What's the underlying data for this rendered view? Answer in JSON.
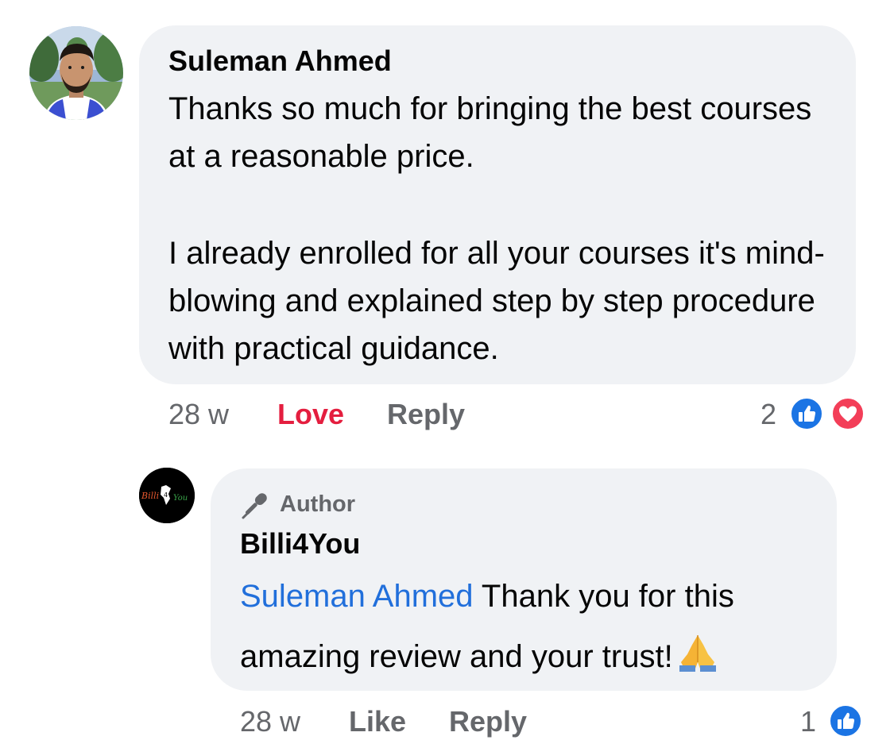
{
  "comment": {
    "author": "Suleman Ahmed",
    "paragraphs": [
      "Thanks so much for bringing the best courses at a reasonable price.",
      "I already enrolled for all your courses it's mind-blowing and explained step by step procedure with practical guidance."
    ],
    "time": "28 w",
    "reaction_action": "Love",
    "reply_label": "Reply",
    "reaction_count": "2",
    "reaction_icons": [
      "like-icon",
      "love-icon"
    ]
  },
  "reply": {
    "badge_label": "Author",
    "badge_icon": "microphone-icon",
    "author": "Billi4You",
    "mention": "Suleman Ahmed",
    "text": " Thank you for this amazing review and your trust!",
    "emoji": "folded-hands-icon",
    "time": "28 w",
    "like_label": "Like",
    "reply_label": "Reply",
    "reaction_count": "1",
    "reaction_icons": [
      "like-icon"
    ],
    "avatar_logo_text": "Billi 4 You"
  },
  "colors": {
    "bubble": "#f0f2f5",
    "meta_text": "#65676b",
    "love_red": "#e41e3f",
    "mention_blue": "#216fdb",
    "like_blue": "#1b74e4",
    "love_pink": "#f33e58"
  }
}
